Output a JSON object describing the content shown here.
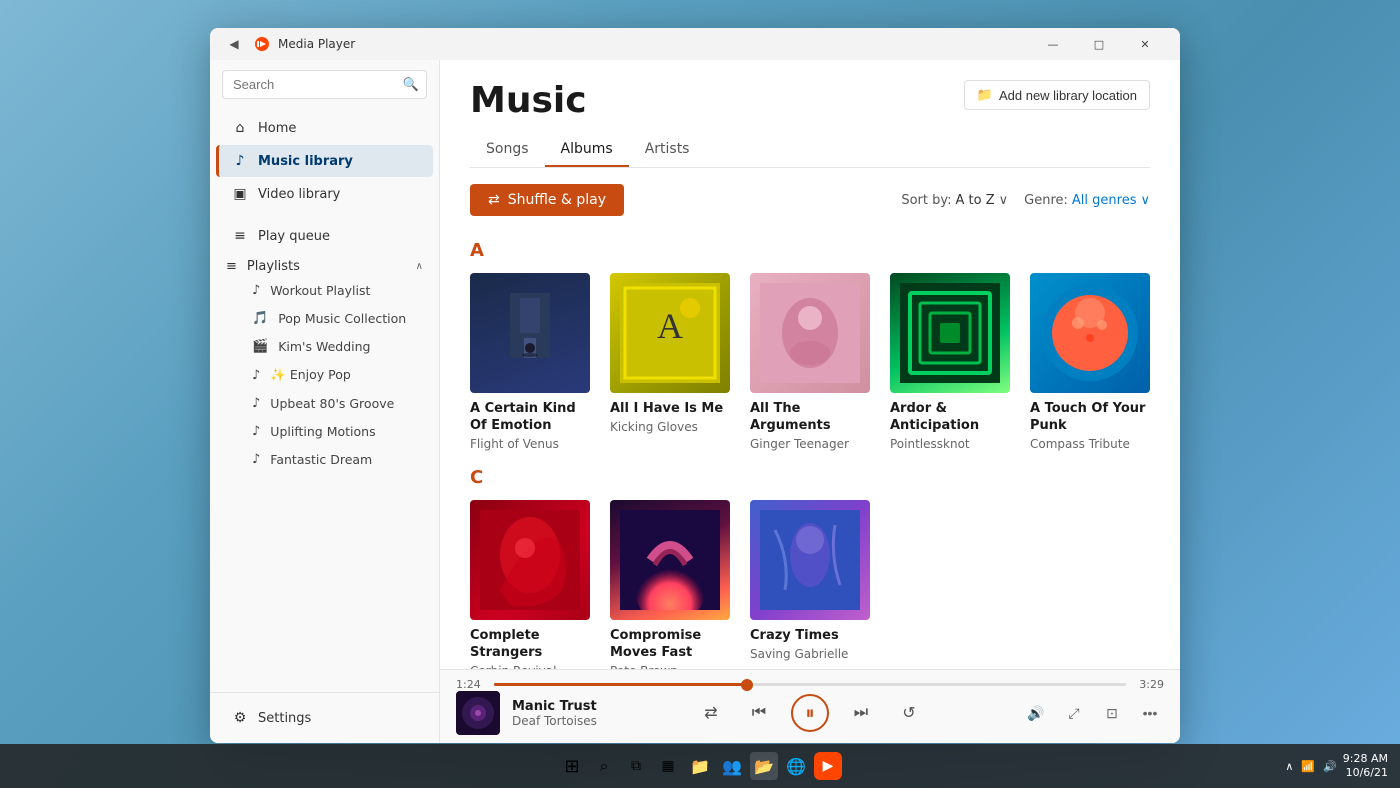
{
  "window": {
    "title": "Media Player",
    "back_icon": "◀",
    "logo": "⏸"
  },
  "title_bar_buttons": {
    "minimize": "—",
    "maximize": "□",
    "close": "✕"
  },
  "sidebar": {
    "search_placeholder": "Search",
    "nav_items": [
      {
        "id": "home",
        "label": "Home",
        "icon": "⌂"
      },
      {
        "id": "music-library",
        "label": "Music library",
        "icon": "♪",
        "active": true
      },
      {
        "id": "video-library",
        "label": "Video library",
        "icon": "▣"
      }
    ],
    "play_queue": {
      "label": "Play queue",
      "icon": "≡"
    },
    "playlists_section": {
      "label": "Playlists",
      "icon": "≡",
      "arrow": "∧",
      "items": [
        {
          "id": "workout",
          "label": "Workout Playlist",
          "icon": "♪"
        },
        {
          "id": "pop-music",
          "label": "Pop Music Collection",
          "icon": "🎵"
        },
        {
          "id": "kims-wedding",
          "label": "Kim's Wedding",
          "icon": "🎬"
        },
        {
          "id": "enjoy-pop",
          "label": "✨ Enjoy Pop",
          "icon": "♪"
        },
        {
          "id": "upbeat",
          "label": "Upbeat 80's Groove",
          "icon": "♪"
        },
        {
          "id": "uplifting",
          "label": "Uplifting Motions",
          "icon": "♪"
        },
        {
          "id": "fantastic",
          "label": "Fantastic Dream",
          "icon": "♪"
        }
      ]
    },
    "settings": {
      "label": "Settings",
      "icon": "⚙"
    }
  },
  "main": {
    "title": "Music",
    "add_library_label": "Add new library location",
    "tabs": [
      {
        "id": "songs",
        "label": "Songs",
        "active": false
      },
      {
        "id": "albums",
        "label": "Albums",
        "active": true
      },
      {
        "id": "artists",
        "label": "Artists",
        "active": false
      }
    ],
    "shuffle_label": "Shuffle & play",
    "sort_label": "Sort by:",
    "sort_value": "A to Z",
    "genre_label": "Genre:",
    "genre_value": "All genres"
  },
  "albums": {
    "sections": [
      {
        "letter": "A",
        "items": [
          {
            "id": "a-certain-kind",
            "title": "A Certain Kind Of Emotion",
            "artist": "Flight of Venus",
            "color1": "#1a2a4a",
            "color2": "#2a3a6a",
            "art_type": "building"
          },
          {
            "id": "all-i-have",
            "title": "All I Have Is Me",
            "artist": "Kicking Gloves",
            "color1": "#d4c800",
            "color2": "#a0a000",
            "art_type": "abstract-yellow"
          },
          {
            "id": "all-the-arguments",
            "title": "All The Arguments",
            "artist": "Ginger Teenager",
            "color1": "#d4a0b0",
            "color2": "#c08090",
            "art_type": "person-sitting"
          },
          {
            "id": "ardor",
            "title": "Ardor & Anticipation",
            "artist": "Pointlessknot",
            "color1": "#00d480",
            "color2": "#009060",
            "art_type": "tunnel-green"
          },
          {
            "id": "touch-of-punk",
            "title": "A Touch Of Your Punk",
            "artist": "Compass Tribute",
            "color1": "#ff6040",
            "color2": "#cc2010",
            "art_type": "astronaut-orange"
          }
        ]
      },
      {
        "letter": "C",
        "items": [
          {
            "id": "complete-strangers",
            "title": "Complete Strangers",
            "artist": "Corbin Revival",
            "color1": "#cc0020",
            "color2": "#880010",
            "art_type": "swimmer-red"
          },
          {
            "id": "compromise",
            "title": "Compromise Moves Fast",
            "artist": "Pete Brown",
            "color1": "#ff6080",
            "color2": "#cc2050",
            "art_type": "palm-sunset"
          },
          {
            "id": "crazy-times",
            "title": "Crazy Times",
            "artist": "Saving Gabrielle",
            "color1": "#4060cc",
            "color2": "#8040cc",
            "art_type": "person-blue"
          }
        ]
      }
    ]
  },
  "now_playing": {
    "track_name": "Manic Trust",
    "artist": "Deaf Tortoises",
    "current_time": "1:24",
    "total_time": "3:29",
    "progress_percent": 40,
    "art_color1": "#1a0a30",
    "art_color2": "#6a1a6a"
  },
  "controls": {
    "shuffle": "⇄",
    "prev": "⏮",
    "pause": "⏸",
    "next": "⏭",
    "repeat": "↺",
    "volume": "🔊",
    "expand": "⤢",
    "miniplayer": "⊡",
    "more": "•••"
  },
  "taskbar": {
    "start_icon": "⊞",
    "search_icon": "⌕",
    "explorer_icon": "📁",
    "widgets_icon": "▦",
    "teams_icon": "👥",
    "files_icon": "📂",
    "edge_icon": "🌐",
    "media_icon": "▶",
    "time": "9:28 AM",
    "date": "10/6/21"
  }
}
